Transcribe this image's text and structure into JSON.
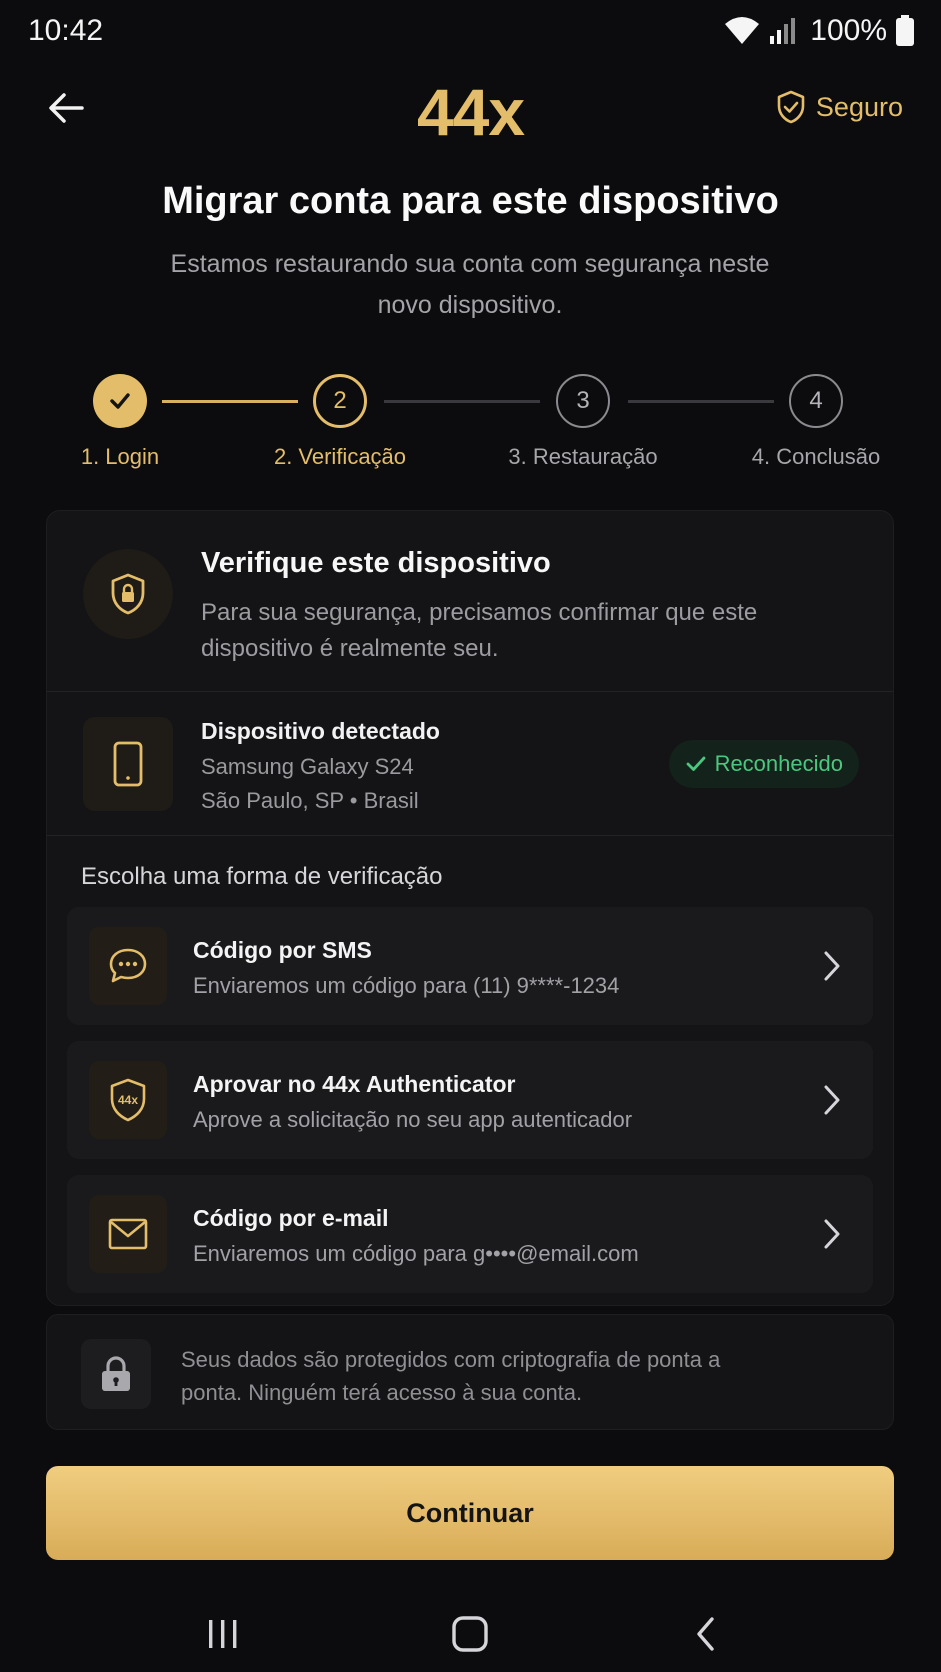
{
  "status_bar": {
    "time": "10:42",
    "battery": "100%"
  },
  "header": {
    "logo": "44x",
    "secure_label": "Seguro"
  },
  "page": {
    "title": "Migrar conta para este dispositivo",
    "subtitle": "Estamos restaurando sua conta com segurança neste novo dispositivo."
  },
  "steps": [
    {
      "label": "1. Login",
      "state": "done"
    },
    {
      "label": "2. Verificação",
      "number": "2",
      "state": "current"
    },
    {
      "label": "3. Restauração",
      "number": "3",
      "state": "pending"
    },
    {
      "label": "4. Conclusão",
      "number": "4",
      "state": "pending"
    }
  ],
  "verify": {
    "title": "Verifique este dispositivo",
    "description": "Para sua segurança, precisamos confirmar que este dispositivo é realmente seu."
  },
  "device": {
    "title": "Dispositivo detectado",
    "model": "Samsung Galaxy S24",
    "location": "São Paulo, SP • Brasil",
    "badge": "Reconhecido"
  },
  "options_label": "Escolha uma forma de verificação",
  "options": [
    {
      "icon": "chat-icon",
      "title": "Código por SMS",
      "description": "Enviaremos um código para (11) 9****-1234"
    },
    {
      "icon": "authenticator-shield-icon",
      "icon_text": "44x",
      "title": "Aprovar no 44x Authenticator",
      "description": "Aprove a solicitação no seu app autenticador"
    },
    {
      "icon": "mail-icon",
      "title": "Código por e-mail",
      "description": "Enviaremos um código para g••••@email.com"
    }
  ],
  "info": {
    "text": "Seus dados são protegidos com criptografia de ponta a ponta. Ninguém terá acesso à sua conta."
  },
  "cta": {
    "label": "Continuar"
  },
  "colors": {
    "accent": "#e4bd6a",
    "success": "#4cc77f",
    "background": "#0c0c0e"
  }
}
